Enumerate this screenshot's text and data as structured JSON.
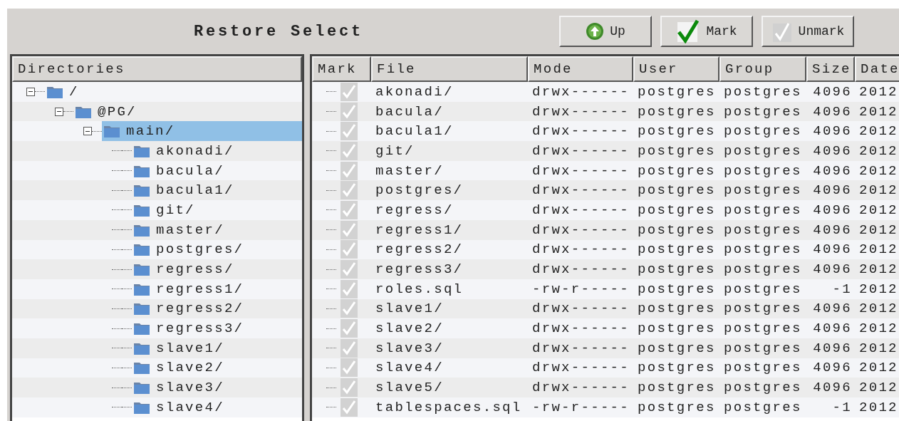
{
  "window": {
    "title": "Restore Select"
  },
  "toolbar": [
    {
      "label": "Up",
      "kind": "up"
    },
    {
      "label": "Mark",
      "kind": "mark"
    },
    {
      "label": "Unmark",
      "kind": "unmark"
    }
  ],
  "directories": {
    "heading": "Directories",
    "tree": [
      {
        "name": "/",
        "expanded": true,
        "selected": false,
        "children": [
          {
            "name": "@PG/",
            "expanded": true,
            "selected": false,
            "children": [
              {
                "name": "main/",
                "expanded": true,
                "selected": true,
                "children": [
                  {
                    "name": "akonadi/",
                    "selected": false
                  },
                  {
                    "name": "bacula/",
                    "selected": false
                  },
                  {
                    "name": "bacula1/",
                    "selected": false
                  },
                  {
                    "name": "git/",
                    "selected": false
                  },
                  {
                    "name": "master/",
                    "selected": false
                  },
                  {
                    "name": "postgres/",
                    "selected": false
                  },
                  {
                    "name": "regress/",
                    "selected": false
                  },
                  {
                    "name": "regress1/",
                    "selected": false
                  },
                  {
                    "name": "regress2/",
                    "selected": false
                  },
                  {
                    "name": "regress3/",
                    "selected": false
                  },
                  {
                    "name": "slave1/",
                    "selected": false
                  },
                  {
                    "name": "slave2/",
                    "selected": false
                  },
                  {
                    "name": "slave3/",
                    "selected": false
                  },
                  {
                    "name": "slave4/",
                    "selected": false
                  }
                ]
              }
            ]
          }
        ]
      }
    ]
  },
  "files": {
    "columns": [
      "Mark",
      "File",
      "Mode",
      "User",
      "Group",
      "Size",
      "Date"
    ],
    "rows": [
      {
        "marked": false,
        "file": "akonadi/",
        "mode": "drwx------",
        "user": "postgres",
        "group": "postgres",
        "size": "4096",
        "date": "2012"
      },
      {
        "marked": false,
        "file": "bacula/",
        "mode": "drwx------",
        "user": "postgres",
        "group": "postgres",
        "size": "4096",
        "date": "2012"
      },
      {
        "marked": false,
        "file": "bacula1/",
        "mode": "drwx------",
        "user": "postgres",
        "group": "postgres",
        "size": "4096",
        "date": "2012"
      },
      {
        "marked": false,
        "file": "git/",
        "mode": "drwx------",
        "user": "postgres",
        "group": "postgres",
        "size": "4096",
        "date": "2012"
      },
      {
        "marked": false,
        "file": "master/",
        "mode": "drwx------",
        "user": "postgres",
        "group": "postgres",
        "size": "4096",
        "date": "2012"
      },
      {
        "marked": false,
        "file": "postgres/",
        "mode": "drwx------",
        "user": "postgres",
        "group": "postgres",
        "size": "4096",
        "date": "2012"
      },
      {
        "marked": false,
        "file": "regress/",
        "mode": "drwx------",
        "user": "postgres",
        "group": "postgres",
        "size": "4096",
        "date": "2012"
      },
      {
        "marked": false,
        "file": "regress1/",
        "mode": "drwx------",
        "user": "postgres",
        "group": "postgres",
        "size": "4096",
        "date": "2012"
      },
      {
        "marked": false,
        "file": "regress2/",
        "mode": "drwx------",
        "user": "postgres",
        "group": "postgres",
        "size": "4096",
        "date": "2012"
      },
      {
        "marked": false,
        "file": "regress3/",
        "mode": "drwx------",
        "user": "postgres",
        "group": "postgres",
        "size": "4096",
        "date": "2012"
      },
      {
        "marked": false,
        "file": "roles.sql",
        "mode": "-rw-r-----",
        "user": "postgres",
        "group": "postgres",
        "size": "-1",
        "date": "2012"
      },
      {
        "marked": false,
        "file": "slave1/",
        "mode": "drwx------",
        "user": "postgres",
        "group": "postgres",
        "size": "4096",
        "date": "2012"
      },
      {
        "marked": false,
        "file": "slave2/",
        "mode": "drwx------",
        "user": "postgres",
        "group": "postgres",
        "size": "4096",
        "date": "2012"
      },
      {
        "marked": false,
        "file": "slave3/",
        "mode": "drwx------",
        "user": "postgres",
        "group": "postgres",
        "size": "4096",
        "date": "2012"
      },
      {
        "marked": false,
        "file": "slave4/",
        "mode": "drwx------",
        "user": "postgres",
        "group": "postgres",
        "size": "4096",
        "date": "2012"
      },
      {
        "marked": false,
        "file": "slave5/",
        "mode": "drwx------",
        "user": "postgres",
        "group": "postgres",
        "size": "4096",
        "date": "2012"
      },
      {
        "marked": false,
        "file": "tablespaces.sql",
        "mode": "-rw-r-----",
        "user": "postgres",
        "group": "postgres",
        "size": "-1",
        "date": "2012"
      }
    ]
  }
}
